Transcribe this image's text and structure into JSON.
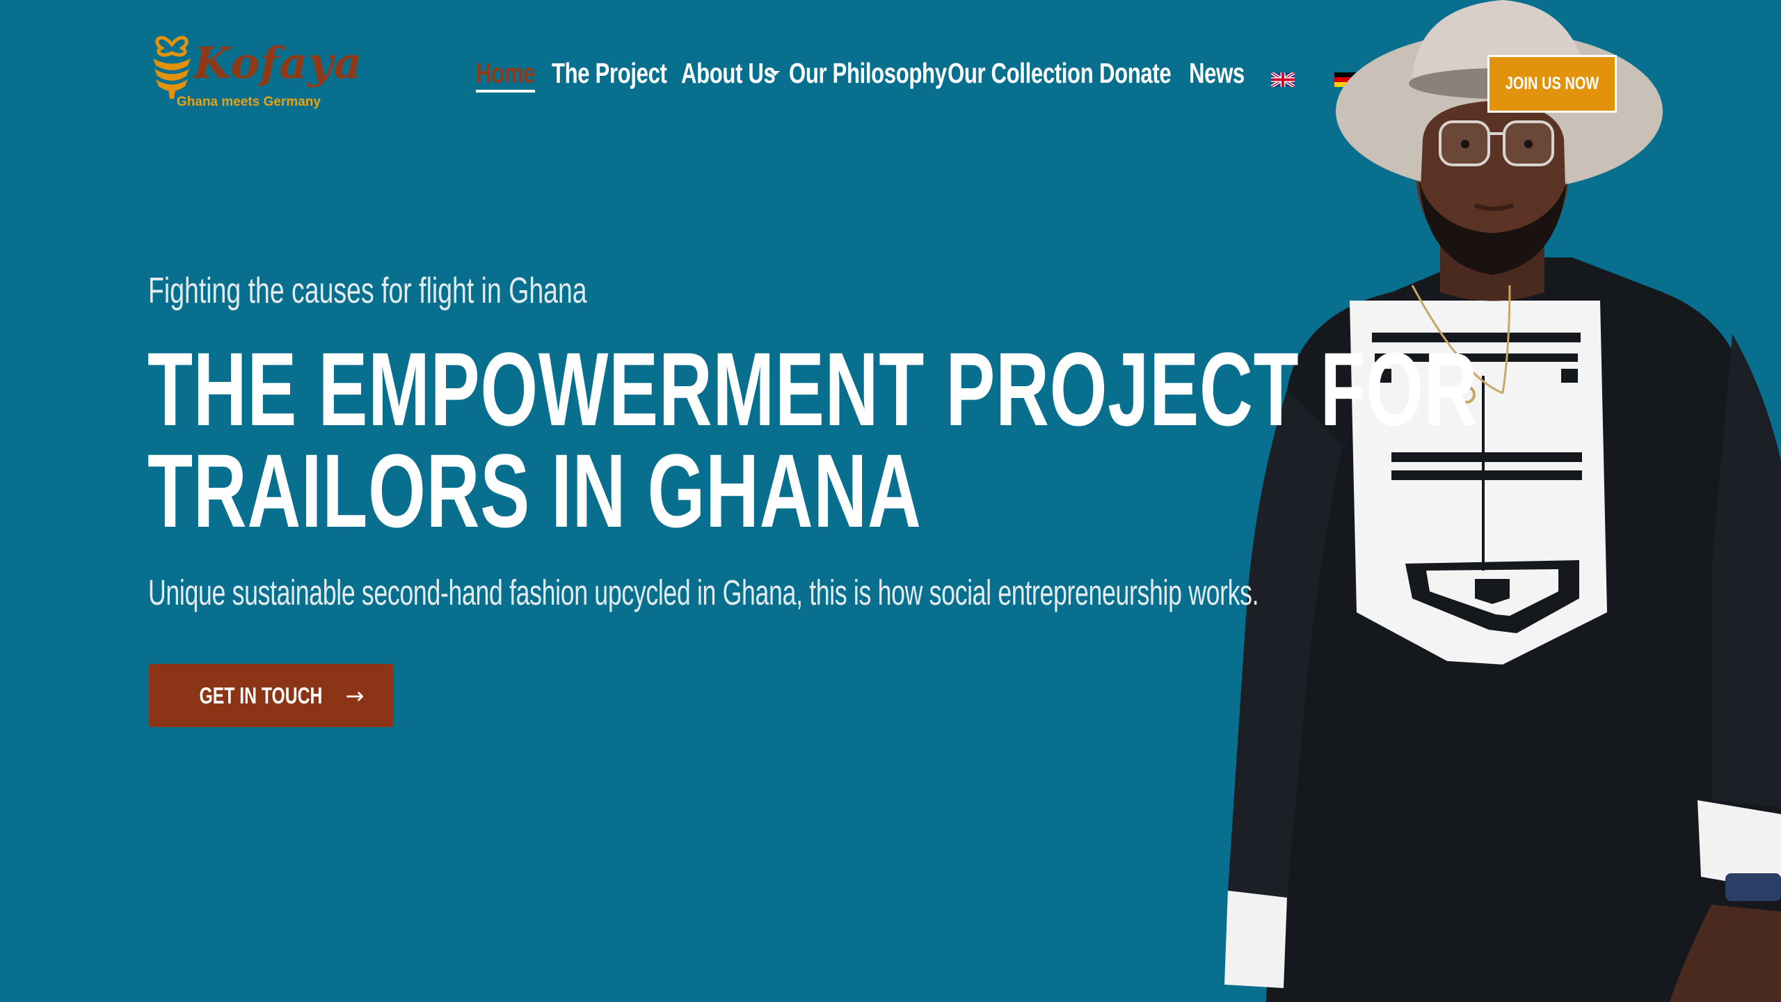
{
  "brand": {
    "name": "Kofaya",
    "tagline": "Ghana meets Germany",
    "colors": {
      "primary_bg": "#08708e",
      "brown": "#8c3416",
      "gold": "#e3920b"
    }
  },
  "nav": {
    "items": [
      {
        "label": "Home",
        "active": true
      },
      {
        "label": "The Project",
        "active": false
      },
      {
        "label": "About Us",
        "active": false,
        "has_dropdown": true
      },
      {
        "label": "Our Philosophy",
        "active": false
      },
      {
        "label": "Our Collection",
        "active": false
      },
      {
        "label": "Donate",
        "active": false
      },
      {
        "label": "News",
        "active": false
      }
    ],
    "languages": [
      "english-flag-icon",
      "german-flag-icon"
    ],
    "join_label": "JOIN US NOW"
  },
  "hero": {
    "eyebrow": "Fighting the causes for flight in Ghana",
    "headline_line1": "THE EMPOWERMENT PROJECT FOR",
    "headline_line2": "TRAILORS IN GHANA",
    "subline": "Unique sustainable second-hand fashion upcycled in Ghana, this is how social entrepreneurship works.",
    "cta_label": "GET IN TOUCH",
    "cta_icon": "arrow-right-icon"
  }
}
